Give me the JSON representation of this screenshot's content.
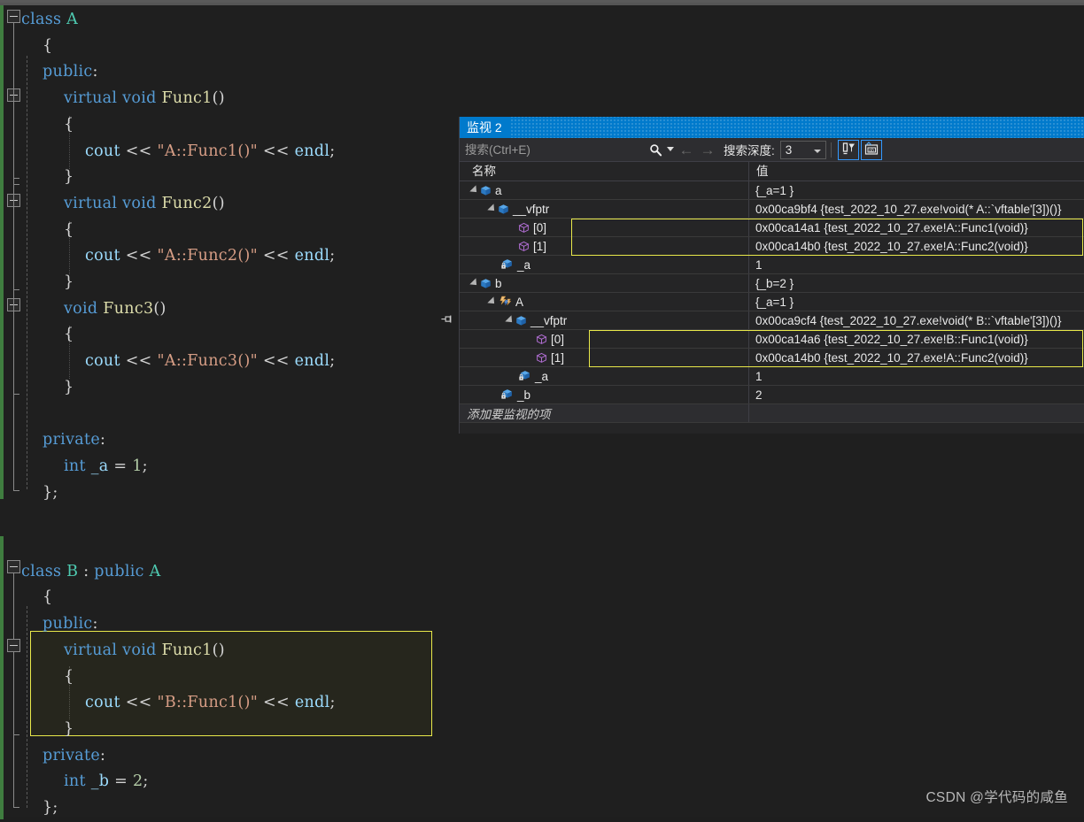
{
  "editor": {
    "language": "cpp",
    "colors": {
      "background": "#1f1f1f",
      "keyword": "#569cd6",
      "type": "#4ec9b0",
      "function": "#dcdcaa",
      "string": "#d69d85",
      "identifier": "#9cdcfe",
      "number": "#b5cea8",
      "punctuation": "#d4d4d4",
      "highlight_border": "#e8e84a",
      "change_bar": "#3f7d3f"
    },
    "lines": [
      {
        "n": 1,
        "indent": 0,
        "tokens": [
          [
            "kw",
            "class"
          ],
          [
            "pun",
            " "
          ],
          [
            "typ",
            "A"
          ]
        ]
      },
      {
        "n": 2,
        "indent": 1,
        "tokens": [
          [
            "pun",
            "{"
          ]
        ]
      },
      {
        "n": 3,
        "indent": 1,
        "tokens": [
          [
            "kw",
            "public"
          ],
          [
            "pun",
            ":"
          ]
        ]
      },
      {
        "n": 4,
        "indent": 2,
        "tokens": [
          [
            "kw",
            "virtual"
          ],
          [
            "pun",
            " "
          ],
          [
            "kw",
            "void"
          ],
          [
            "pun",
            " "
          ],
          [
            "fn",
            "Func1"
          ],
          [
            "pun",
            "()"
          ]
        ]
      },
      {
        "n": 5,
        "indent": 2,
        "tokens": [
          [
            "pun",
            "{"
          ]
        ]
      },
      {
        "n": 6,
        "indent": 3,
        "tokens": [
          [
            "id",
            "cout"
          ],
          [
            "pun",
            " "
          ],
          [
            "op",
            "<<"
          ],
          [
            "pun",
            " "
          ],
          [
            "str",
            "\"A::Func1()\""
          ],
          [
            "pun",
            " "
          ],
          [
            "op",
            "<<"
          ],
          [
            "pun",
            " "
          ],
          [
            "id",
            "endl"
          ],
          [
            "pun",
            ";"
          ]
        ]
      },
      {
        "n": 7,
        "indent": 2,
        "tokens": [
          [
            "pun",
            "}"
          ]
        ]
      },
      {
        "n": 8,
        "indent": 2,
        "tokens": [
          [
            "kw",
            "virtual"
          ],
          [
            "pun",
            " "
          ],
          [
            "kw",
            "void"
          ],
          [
            "pun",
            " "
          ],
          [
            "fn",
            "Func2"
          ],
          [
            "pun",
            "()"
          ]
        ]
      },
      {
        "n": 9,
        "indent": 2,
        "tokens": [
          [
            "pun",
            "{"
          ]
        ]
      },
      {
        "n": 10,
        "indent": 3,
        "tokens": [
          [
            "id",
            "cout"
          ],
          [
            "pun",
            " "
          ],
          [
            "op",
            "<<"
          ],
          [
            "pun",
            " "
          ],
          [
            "str",
            "\"A::Func2()\""
          ],
          [
            "pun",
            " "
          ],
          [
            "op",
            "<<"
          ],
          [
            "pun",
            " "
          ],
          [
            "id",
            "endl"
          ],
          [
            "pun",
            ";"
          ]
        ]
      },
      {
        "n": 11,
        "indent": 2,
        "tokens": [
          [
            "pun",
            "}"
          ]
        ]
      },
      {
        "n": 12,
        "indent": 2,
        "tokens": [
          [
            "kw",
            "void"
          ],
          [
            "pun",
            " "
          ],
          [
            "fn",
            "Func3"
          ],
          [
            "pun",
            "()"
          ]
        ]
      },
      {
        "n": 13,
        "indent": 2,
        "tokens": [
          [
            "pun",
            "{"
          ]
        ]
      },
      {
        "n": 14,
        "indent": 3,
        "tokens": [
          [
            "id",
            "cout"
          ],
          [
            "pun",
            " "
          ],
          [
            "op",
            "<<"
          ],
          [
            "pun",
            " "
          ],
          [
            "str",
            "\"A::Func3()\""
          ],
          [
            "pun",
            " "
          ],
          [
            "op",
            "<<"
          ],
          [
            "pun",
            " "
          ],
          [
            "id",
            "endl"
          ],
          [
            "pun",
            ";"
          ]
        ]
      },
      {
        "n": 15,
        "indent": 2,
        "tokens": [
          [
            "pun",
            "}"
          ]
        ]
      },
      {
        "n": 16,
        "indent": 0,
        "tokens": []
      },
      {
        "n": 17,
        "indent": 1,
        "tokens": [
          [
            "kw",
            "private"
          ],
          [
            "pun",
            ":"
          ]
        ]
      },
      {
        "n": 18,
        "indent": 2,
        "tokens": [
          [
            "kw",
            "int"
          ],
          [
            "pun",
            " "
          ],
          [
            "id",
            "_a"
          ],
          [
            "pun",
            " "
          ],
          [
            "op",
            "="
          ],
          [
            "pun",
            " "
          ],
          [
            "num",
            "1"
          ],
          [
            "pun",
            ";"
          ]
        ]
      },
      {
        "n": 19,
        "indent": 1,
        "tokens": [
          [
            "pun",
            "};"
          ]
        ]
      },
      {
        "n": 20,
        "indent": 0,
        "tokens": []
      },
      {
        "n": 21,
        "indent": 0,
        "tokens": []
      },
      {
        "n": 22,
        "indent": 0,
        "tokens": [
          [
            "kw",
            "class"
          ],
          [
            "pun",
            " "
          ],
          [
            "typ",
            "B"
          ],
          [
            "pun",
            " : "
          ],
          [
            "kw",
            "public"
          ],
          [
            "pun",
            " "
          ],
          [
            "typ",
            "A"
          ]
        ]
      },
      {
        "n": 23,
        "indent": 1,
        "tokens": [
          [
            "pun",
            "{"
          ]
        ]
      },
      {
        "n": 24,
        "indent": 1,
        "tokens": [
          [
            "kw",
            "public"
          ],
          [
            "pun",
            ":"
          ]
        ]
      },
      {
        "n": 25,
        "indent": 2,
        "tokens": [
          [
            "kw",
            "virtual"
          ],
          [
            "pun",
            " "
          ],
          [
            "kw",
            "void"
          ],
          [
            "pun",
            " "
          ],
          [
            "fn",
            "Func1"
          ],
          [
            "pun",
            "()"
          ]
        ]
      },
      {
        "n": 26,
        "indent": 2,
        "tokens": [
          [
            "pun",
            "{"
          ]
        ]
      },
      {
        "n": 27,
        "indent": 3,
        "tokens": [
          [
            "id",
            "cout"
          ],
          [
            "pun",
            " "
          ],
          [
            "op",
            "<<"
          ],
          [
            "pun",
            " "
          ],
          [
            "str",
            "\"B::Func1()\""
          ],
          [
            "pun",
            " "
          ],
          [
            "op",
            "<<"
          ],
          [
            "pun",
            " "
          ],
          [
            "id",
            "endl"
          ],
          [
            "pun",
            ";"
          ]
        ]
      },
      {
        "n": 28,
        "indent": 2,
        "tokens": [
          [
            "pun",
            "}"
          ]
        ]
      },
      {
        "n": 29,
        "indent": 1,
        "tokens": [
          [
            "kw",
            "private"
          ],
          [
            "pun",
            ":"
          ]
        ]
      },
      {
        "n": 30,
        "indent": 2,
        "tokens": [
          [
            "kw",
            "int"
          ],
          [
            "pun",
            " "
          ],
          [
            "id",
            "_b"
          ],
          [
            "pun",
            " "
          ],
          [
            "op",
            "="
          ],
          [
            "pun",
            " "
          ],
          [
            "num",
            "2"
          ],
          [
            "pun",
            ";"
          ]
        ]
      },
      {
        "n": 31,
        "indent": 1,
        "tokens": [
          [
            "pun",
            "};"
          ]
        ]
      }
    ]
  },
  "watch": {
    "title": "监视 2",
    "search": {
      "placeholder": "搜索(Ctrl+E)",
      "value": "",
      "icon": "search-icon"
    },
    "toolbar": {
      "back_icon": "arrow-left-icon",
      "forward_icon": "arrow-right-icon",
      "depth_label": "搜索深度:",
      "depth_value": "3",
      "filter_button_icon": "pin-filter-icon",
      "hex_button_icon": "hex-display-icon"
    },
    "columns": {
      "name": "名称",
      "value": "值"
    },
    "rows": [
      {
        "depth": 0,
        "expander": "expanded",
        "icon": "blue-cube-icon",
        "name": "a",
        "value": "{_a=1 }",
        "pinned": false,
        "highlight": false
      },
      {
        "depth": 1,
        "expander": "expanded",
        "icon": "blue-cube-icon",
        "name": "__vfptr",
        "value": "0x00ca9bf4 {test_2022_10_27.exe!void(* A::`vftable'[3])()}",
        "pinned": false,
        "highlight": false
      },
      {
        "depth": 2,
        "expander": "none",
        "icon": "purple-cube-icon",
        "name": "[0]",
        "value": "0x00ca14a1 {test_2022_10_27.exe!A::Func1(void)}",
        "pinned": false,
        "highlight": true
      },
      {
        "depth": 2,
        "expander": "none",
        "icon": "purple-cube-icon",
        "name": "[1]",
        "value": "0x00ca14b0 {test_2022_10_27.exe!A::Func2(void)}",
        "pinned": false,
        "highlight": true
      },
      {
        "depth": 1,
        "expander": "none",
        "icon": "private-cube-icon",
        "name": "_a",
        "value": "1",
        "pinned": false,
        "highlight": false
      },
      {
        "depth": 0,
        "expander": "expanded",
        "icon": "blue-cube-icon",
        "name": "b",
        "value": "{_b=2 }",
        "pinned": false,
        "highlight": false
      },
      {
        "depth": 1,
        "expander": "expanded",
        "icon": "base-class-icon",
        "name": "A",
        "value": "{_a=1 }",
        "pinned": false,
        "highlight": false
      },
      {
        "depth": 2,
        "expander": "expanded",
        "icon": "blue-cube-icon",
        "name": "__vfptr",
        "value": "0x00ca9cf4 {test_2022_10_27.exe!void(* B::`vftable'[3])()}",
        "pinned": true,
        "highlight": false
      },
      {
        "depth": 3,
        "expander": "none",
        "icon": "purple-cube-icon",
        "name": "[0]",
        "value": "0x00ca14a6 {test_2022_10_27.exe!B::Func1(void)}",
        "pinned": false,
        "highlight": true
      },
      {
        "depth": 3,
        "expander": "none",
        "icon": "purple-cube-icon",
        "name": "[1]",
        "value": "0x00ca14b0 {test_2022_10_27.exe!A::Func2(void)}",
        "pinned": false,
        "highlight": true
      },
      {
        "depth": 2,
        "expander": "none",
        "icon": "private-cube-icon",
        "name": "_a",
        "value": "1",
        "pinned": false,
        "highlight": false
      },
      {
        "depth": 1,
        "expander": "none",
        "icon": "private-cube-icon",
        "name": "_b",
        "value": "2",
        "pinned": false,
        "highlight": false
      }
    ],
    "add_item_row": {
      "placeholder": "添加要监视的项",
      "value": ""
    }
  },
  "watermark": "CSDN @学代码的咸鱼"
}
